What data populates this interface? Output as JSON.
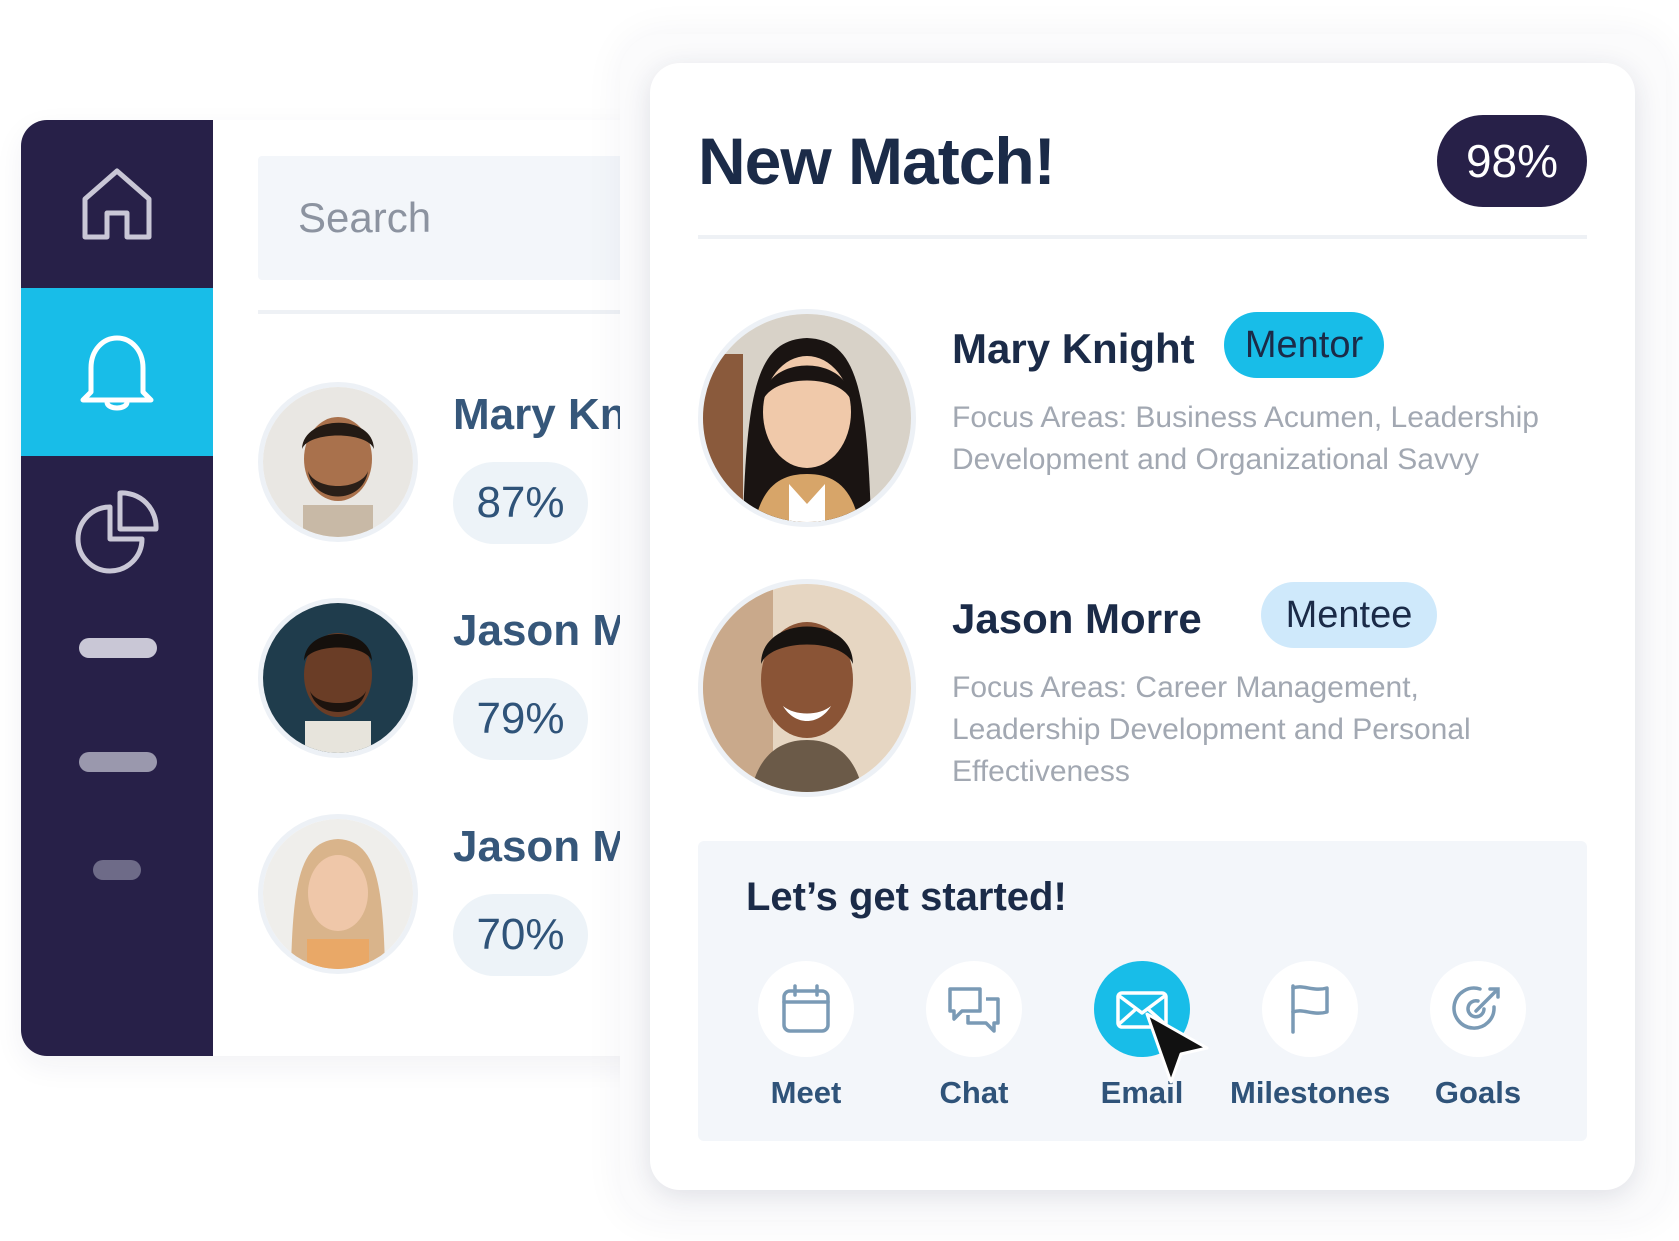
{
  "sidebar": {
    "items": [
      {
        "icon": "home-icon"
      },
      {
        "icon": "bell-icon",
        "active": true
      },
      {
        "icon": "pie-chart-icon"
      }
    ]
  },
  "search": {
    "placeholder": "Search"
  },
  "list": [
    {
      "name": "Mary Kni",
      "percent": "87%"
    },
    {
      "name": "Jason Mo",
      "percent": "79%"
    },
    {
      "name": "Jason Mo",
      "percent": "70%"
    }
  ],
  "match": {
    "title": "New Match!",
    "score": "98%",
    "people": [
      {
        "name": "Mary Knight",
        "role": "Mentor",
        "focus": "Focus Areas: Business Acumen, Leadership Development and Organizational Savvy"
      },
      {
        "name": "Jason Morre",
        "role": "Mentee",
        "focus": "Focus Areas: Career Management, Leadership Development and Personal Effectiveness"
      }
    ],
    "start": {
      "title": "Let’s get started!",
      "actions": [
        {
          "label": "Meet",
          "icon": "calendar-icon"
        },
        {
          "label": "Chat",
          "icon": "chat-icon"
        },
        {
          "label": "Email",
          "icon": "email-icon",
          "active": true
        },
        {
          "label": "Milestones",
          "icon": "flag-icon"
        },
        {
          "label": "Goals",
          "icon": "target-icon"
        }
      ]
    }
  },
  "colors": {
    "sidebar": "#272048",
    "accent": "#18bde8",
    "heading": "#1b2b48",
    "muted": "#a2a8b2",
    "mentee_badge": "#cfe9fb"
  }
}
